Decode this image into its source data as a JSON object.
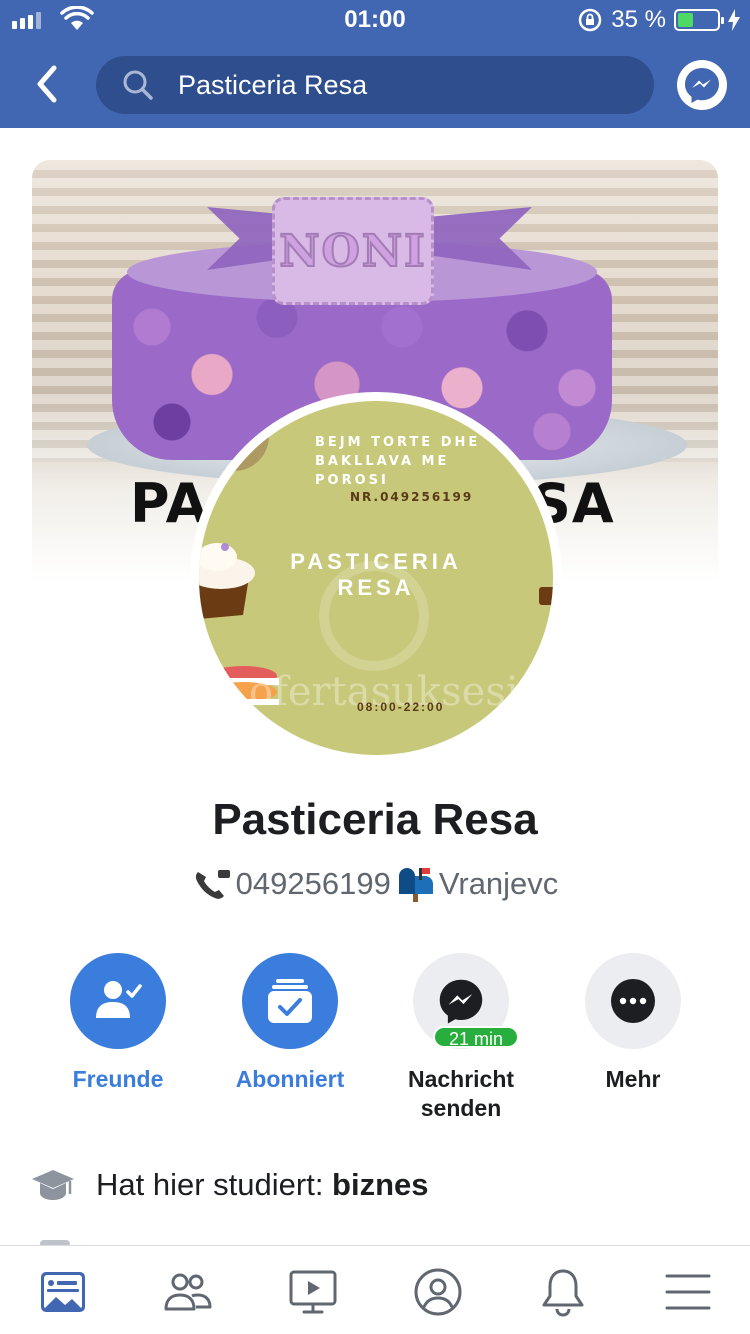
{
  "status_bar": {
    "time": "01:00",
    "battery_percent": "35 %",
    "battery_level": 0.35,
    "signal_bars": 4
  },
  "header": {
    "search_value": "Pasticeria Resa",
    "back_icon": "chevron-left-icon",
    "messenger_icon": "messenger-icon"
  },
  "cover": {
    "text_left": "PA",
    "text_right": "SA",
    "cake_text": "NONI"
  },
  "profile_picture": {
    "line1": "BEJM TORTE DHE",
    "line2": "BAKLLAVA ME",
    "line3": "POROSI",
    "phone_line": "NR.049256199",
    "brand_line1": "PASTICERIA",
    "brand_line2": "RESA",
    "watermark": "ofertasuksesi",
    "hours": "08:00-22:00"
  },
  "profile": {
    "name": "Pasticeria Resa",
    "phone": "049256199",
    "location": "Vranjevc"
  },
  "actions": [
    {
      "label": "Freunde",
      "icon": "friends-check-icon",
      "style": "primary"
    },
    {
      "label": "Abonniert",
      "icon": "subscribed-icon",
      "style": "primary"
    },
    {
      "label_line1": "Nachricht",
      "label_line2": "senden",
      "icon": "messenger-icon",
      "badge": "21 min",
      "style": "secondary"
    },
    {
      "label": "Mehr",
      "icon": "more-dots-icon",
      "style": "secondary"
    }
  ],
  "info": {
    "prefix": "Hat hier studiert: ",
    "value": "biznes",
    "icon": "graduation-cap-icon"
  },
  "tabbar": [
    {
      "name": "news-feed",
      "icon": "news-feed-icon",
      "active": true
    },
    {
      "name": "friends",
      "icon": "friends-icon",
      "active": false
    },
    {
      "name": "watch",
      "icon": "watch-icon",
      "active": false
    },
    {
      "name": "profile",
      "icon": "profile-icon",
      "active": false
    },
    {
      "name": "notifications",
      "icon": "bell-icon",
      "active": false
    },
    {
      "name": "menu",
      "icon": "menu-icon",
      "active": false
    }
  ],
  "colors": {
    "brand_blue": "#4267b2",
    "action_blue": "#3b7ddd",
    "badge_green": "#27ae3d"
  }
}
